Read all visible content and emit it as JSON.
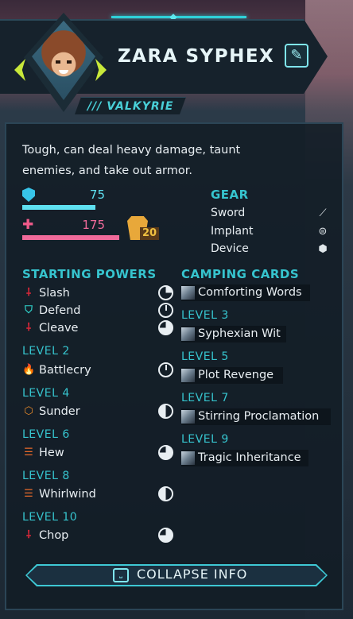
{
  "character": {
    "name": "ZARA SYPHEX",
    "class": "/// VALKYRIE",
    "description": "Tough, can deal heavy damage, taunt enemies, and take out armor.",
    "shield": "75",
    "shield_fraction": 0.75,
    "health": "175",
    "health_fraction": 1.0,
    "armor": "20"
  },
  "gear": {
    "title": "GEAR",
    "items": [
      {
        "label": "Sword",
        "icon": "sword-icon"
      },
      {
        "label": "Implant",
        "icon": "implant-icon"
      },
      {
        "label": "Device",
        "icon": "device-icon"
      }
    ]
  },
  "powers": {
    "title": "STARTING POWERS",
    "starting": [
      {
        "name": "Slash",
        "icon": "slash-icon",
        "cost": "quarter"
      },
      {
        "name": "Defend",
        "icon": "defend-icon",
        "cost": "zero"
      },
      {
        "name": "Cleave",
        "icon": "cleave-icon",
        "cost": "three-quarter"
      }
    ],
    "levels": [
      {
        "level": "LEVEL 2",
        "name": "Battlecry",
        "icon": "battlecry-icon",
        "cost": "zero"
      },
      {
        "level": "LEVEL 4",
        "name": "Sunder",
        "icon": "sunder-icon",
        "cost": "half"
      },
      {
        "level": "LEVEL 6",
        "name": "Hew",
        "icon": "hew-icon",
        "cost": "three-quarter"
      },
      {
        "level": "LEVEL 8",
        "name": "Whirlwind",
        "icon": "whirlwind-icon",
        "cost": "half"
      },
      {
        "level": "LEVEL 10",
        "name": "Chop",
        "icon": "chop-icon",
        "cost": "three-quarter"
      }
    ]
  },
  "camping": {
    "title": "CAMPING CARDS",
    "starting": "Comforting Words",
    "levels": [
      {
        "level": "LEVEL 3",
        "name": "Syphexian Wit"
      },
      {
        "level": "LEVEL 5",
        "name": "Plot Revenge"
      },
      {
        "level": "LEVEL 7",
        "name": "Stirring Proclamation"
      },
      {
        "level": "LEVEL 9",
        "name": "Tragic Inheritance"
      }
    ]
  },
  "collapse": {
    "label": "COLLAPSE INFO",
    "key_glyph": "⎵"
  },
  "colors": {
    "accent": "#36c4ce",
    "shield": "#5ee0f0",
    "health": "#f06a9a",
    "armor": "#e8a83a"
  }
}
